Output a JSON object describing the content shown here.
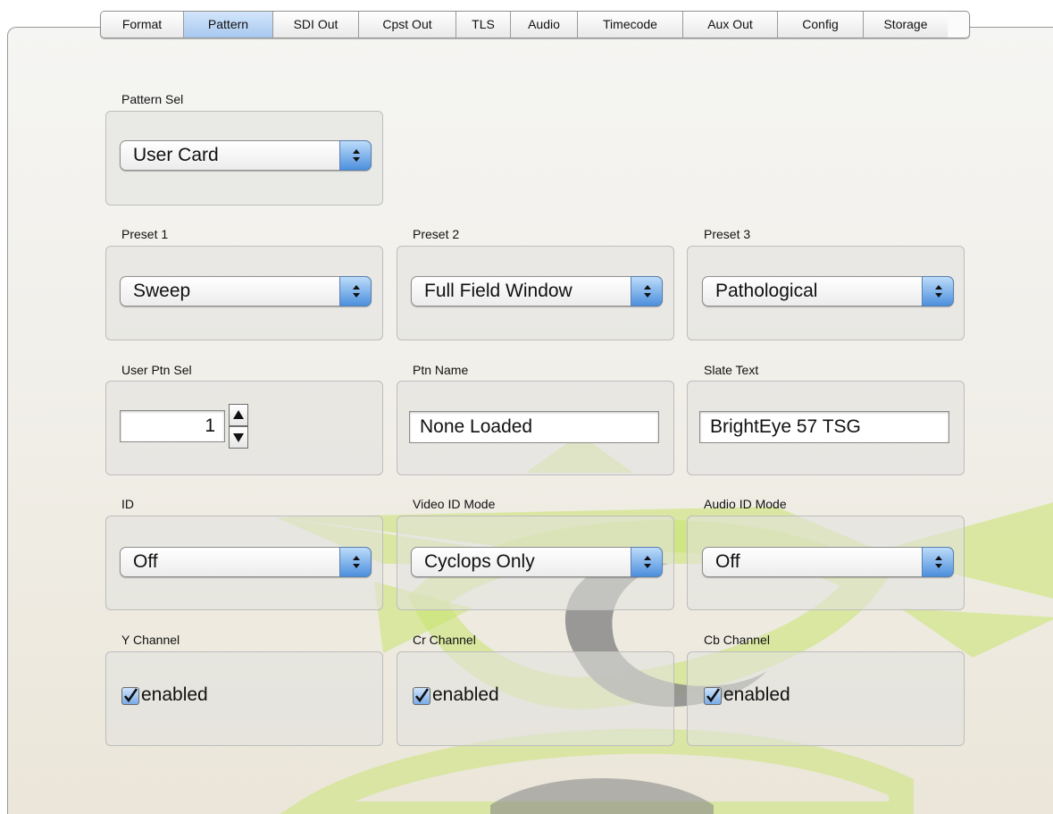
{
  "tabs": [
    "Format",
    "Pattern",
    "SDI Out",
    "Cpst Out",
    "TLS",
    "Audio",
    "Timecode",
    "Aux Out",
    "Config",
    "Storage"
  ],
  "active_tab": "Pattern",
  "pattern_sel": {
    "label": "Pattern Sel",
    "value": "User Card"
  },
  "preset1": {
    "label": "Preset 1",
    "value": "Sweep"
  },
  "preset2": {
    "label": "Preset 2",
    "value": "Full Field Window"
  },
  "preset3": {
    "label": "Preset 3",
    "value": "Pathological"
  },
  "user_ptn_sel": {
    "label": "User Ptn Sel",
    "value": "1"
  },
  "ptn_name": {
    "label": "Ptn Name",
    "value": "None Loaded"
  },
  "slate_text": {
    "label": "Slate Text",
    "value": "BrightEye 57 TSG"
  },
  "id": {
    "label": "ID",
    "value": "Off"
  },
  "video_id_mode": {
    "label": "Video ID Mode",
    "value": "Cyclops Only"
  },
  "audio_id_mode": {
    "label": "Audio ID Mode",
    "value": "Off"
  },
  "y_channel": {
    "label": "Y Channel",
    "checkbox_label": "enabled",
    "checked": true
  },
  "cr_channel": {
    "label": "Cr Channel",
    "checkbox_label": "enabled",
    "checked": true
  },
  "cb_channel": {
    "label": "Cb Channel",
    "checkbox_label": "enabled",
    "checked": true
  },
  "colors": {
    "tab_active": "#a8c8ef",
    "stepper": "#4d8fdd",
    "watermark_green": "#c8e36b",
    "watermark_gray": "#8a8a8a"
  }
}
